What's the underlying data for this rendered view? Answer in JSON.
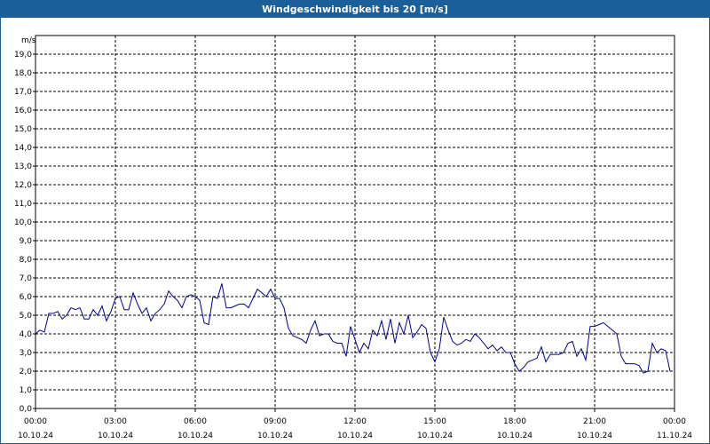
{
  "chart_data": {
    "type": "line",
    "title": "Windgeschwindigkeit bis 20 [m/s]",
    "ylabel": "m/s",
    "ylim": [
      0,
      20
    ],
    "yticks": [
      "0,0",
      "1,0",
      "2,0",
      "3,0",
      "4,0",
      "5,0",
      "6,0",
      "7,0",
      "8,0",
      "9,0",
      "10,0",
      "11,0",
      "12,0",
      "13,0",
      "14,0",
      "15,0",
      "16,0",
      "17,0",
      "18,0",
      "19,0"
    ],
    "xlim": [
      "2024-10-10 00:00",
      "2024-10-11 00:00"
    ],
    "xticks": [
      {
        "time": "00:00",
        "date": "10.10.24"
      },
      {
        "time": "03:00",
        "date": "10.10.24"
      },
      {
        "time": "06:00",
        "date": "10.10.24"
      },
      {
        "time": "09:00",
        "date": "10.10.24"
      },
      {
        "time": "12:00",
        "date": "10.10.24"
      },
      {
        "time": "15:00",
        "date": "10.10.24"
      },
      {
        "time": "18:00",
        "date": "10.10.24"
      },
      {
        "time": "21:00",
        "date": "10.10.24"
      },
      {
        "time": "00:00",
        "date": "11.10.24"
      }
    ],
    "grid": true,
    "line_color": "#00008b",
    "series": [
      {
        "x": [
          "00:00",
          "00:10",
          "00:20",
          "00:30",
          "00:40",
          "00:50",
          "01:00",
          "01:10",
          "01:20",
          "01:30",
          "01:40",
          "01:50",
          "02:00",
          "02:10",
          "02:20",
          "02:30",
          "02:40",
          "02:50",
          "03:00",
          "03:10",
          "03:20",
          "03:30",
          "03:40",
          "03:50",
          "04:00",
          "04:10",
          "04:20",
          "04:30",
          "04:40",
          "04:50",
          "05:00",
          "05:10",
          "05:20",
          "05:30",
          "05:40",
          "05:50",
          "06:00",
          "06:10",
          "06:20",
          "06:30",
          "06:40",
          "06:50",
          "07:00",
          "07:10",
          "07:20",
          "07:30",
          "07:40",
          "07:50",
          "08:00",
          "08:10",
          "08:20",
          "08:30",
          "08:40",
          "08:50",
          "09:00",
          "09:10",
          "09:20",
          "09:30",
          "09:40",
          "09:50",
          "10:00",
          "10:10",
          "10:20",
          "10:30",
          "10:40",
          "10:50",
          "11:00",
          "11:10",
          "11:20",
          "11:30",
          "11:40",
          "11:50",
          "12:00",
          "12:10",
          "12:20",
          "12:30",
          "12:40",
          "12:50",
          "13:00",
          "13:10",
          "13:20",
          "13:30",
          "13:40",
          "13:50",
          "14:00",
          "14:10",
          "14:20",
          "14:30",
          "14:40",
          "14:50",
          "15:00",
          "15:10",
          "15:20",
          "15:30",
          "15:40",
          "15:50",
          "16:00",
          "16:10",
          "16:20",
          "16:30",
          "16:40",
          "16:50",
          "17:00",
          "17:10",
          "17:20",
          "17:30",
          "17:40",
          "17:50",
          "18:00",
          "18:10",
          "18:20",
          "18:30",
          "18:40",
          "18:50",
          "19:00",
          "19:10",
          "19:20",
          "19:30",
          "19:40",
          "19:50",
          "20:00",
          "20:10",
          "20:20",
          "20:30",
          "20:40",
          "20:50",
          "21:00",
          "21:10",
          "21:20",
          "21:30",
          "21:40",
          "21:50",
          "22:00",
          "22:10",
          "22:20",
          "22:30",
          "22:40",
          "22:50",
          "23:00",
          "23:10",
          "23:20",
          "23:30",
          "23:40",
          "23:50"
        ],
        "values": [
          4.0,
          4.2,
          4.1,
          5.1,
          5.1,
          5.2,
          4.8,
          5.0,
          5.4,
          5.3,
          5.4,
          4.8,
          4.8,
          5.3,
          5.0,
          5.5,
          4.7,
          5.2,
          5.9,
          6.0,
          5.3,
          5.3,
          6.2,
          5.6,
          5.1,
          5.4,
          4.7,
          5.1,
          5.3,
          5.6,
          6.3,
          6.0,
          5.8,
          5.4,
          6.0,
          6.1,
          6.0,
          5.8,
          4.6,
          4.5,
          6.0,
          5.9,
          6.7,
          5.4,
          5.4,
          5.5,
          5.6,
          5.6,
          5.4,
          5.9,
          6.4,
          6.2,
          6.0,
          6.4,
          5.9,
          5.9,
          5.4,
          4.3,
          3.9,
          3.8,
          3.7,
          3.5,
          4.2,
          4.7,
          3.9,
          4.0,
          4.0,
          3.6,
          3.5,
          3.5,
          2.8,
          4.4,
          3.7,
          3.0,
          3.5,
          3.2,
          4.2,
          3.9,
          4.7,
          3.7,
          4.8,
          3.5,
          4.6,
          4.0,
          5.0,
          3.8,
          4.1,
          4.5,
          4.3,
          3.0,
          2.5,
          3.2,
          4.9,
          4.2,
          3.6,
          3.4,
          3.5,
          3.7,
          3.6,
          4.0,
          3.8,
          3.5,
          3.2,
          3.4,
          3.1,
          3.3,
          3.0,
          3.0,
          2.4,
          2.0,
          2.2,
          2.5,
          2.6,
          2.7,
          3.3,
          2.5,
          2.9,
          2.9,
          2.9,
          3.0,
          3.5,
          3.6,
          2.8,
          3.2,
          2.6,
          4.4,
          4.4,
          4.5,
          4.6,
          4.4,
          4.2,
          4.0,
          2.8,
          2.4,
          2.4,
          2.4,
          2.3,
          1.9,
          2.0,
          3.5,
          3.0,
          3.2,
          3.1,
          2.0
        ]
      }
    ]
  }
}
